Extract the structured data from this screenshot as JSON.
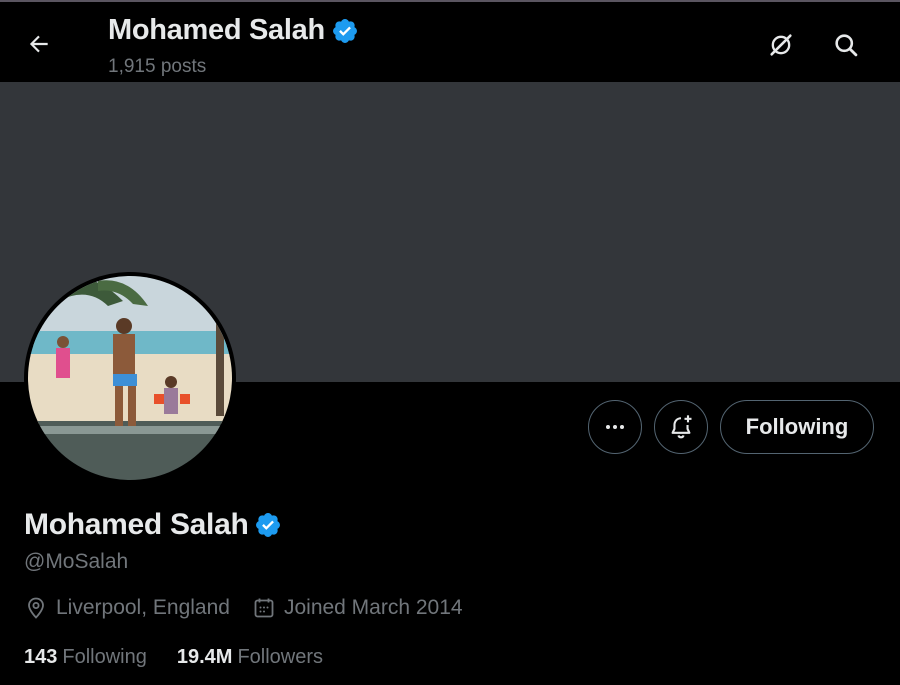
{
  "header": {
    "name": "Mohamed Salah",
    "posts": "1,915 posts",
    "icons": [
      "back-arrow-icon",
      "verified-badge-icon",
      "grok-icon",
      "search-icon"
    ]
  },
  "profile": {
    "name": "Mohamed Salah",
    "handle": "@MoSalah",
    "location": "Liverpool, England",
    "joined": "Joined March 2014",
    "following_count": "143",
    "following_label": "Following",
    "followers_count": "19.4M",
    "followers_label": "Followers"
  },
  "actions": {
    "more_icon": "more-options-icon",
    "notify_icon": "notification-bell-icon",
    "following_button": "Following"
  },
  "colors": {
    "background": "#000000",
    "banner": "#33363a",
    "primary_text": "#e7e9ea",
    "secondary_text": "#71767b",
    "verified_blue": "#1d9bf0",
    "button_border": "#536471"
  }
}
